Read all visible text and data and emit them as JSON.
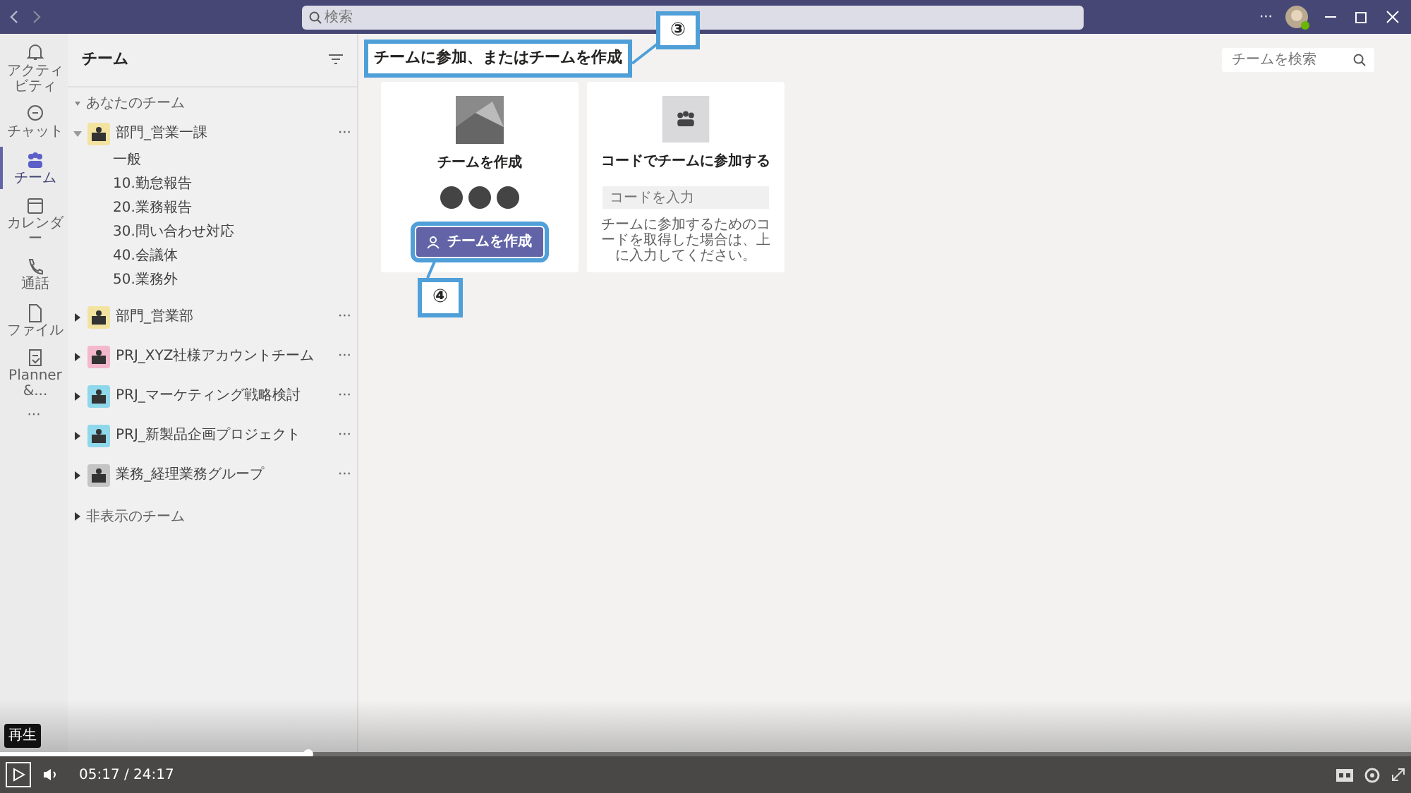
{
  "titlebar": {
    "search_placeholder": "検索",
    "more": "···"
  },
  "rail": [
    {
      "label": "アクティビティ",
      "selected": false
    },
    {
      "label": "チャット",
      "selected": false
    },
    {
      "label": "チーム",
      "selected": true
    },
    {
      "label": "カレンダー",
      "selected": false
    },
    {
      "label": "通話",
      "selected": false
    },
    {
      "label": "ファイル",
      "selected": false
    },
    {
      "label": "Planner &...",
      "selected": false
    }
  ],
  "rail_more": "···",
  "panel": {
    "title": "チーム",
    "section": "あなたのチーム",
    "hidden_section": "非表示のチーム",
    "teams": [
      {
        "name": "部門_営業一課",
        "color": "#f3e3a0",
        "expanded": true,
        "more": "···",
        "channels": [
          "一般",
          "10.勤怠報告",
          "20.業務報告",
          "30.問い合わせ対応",
          "40.会議体",
          "50.業務外"
        ]
      },
      {
        "name": "部門_営業部",
        "color": "#f3e3a0",
        "expanded": false,
        "more": "···"
      },
      {
        "name": "PRJ_XYZ社様アカウントチーム",
        "color": "#f4b8cc",
        "expanded": false,
        "more": "···"
      },
      {
        "name": "PRJ_マーケティング戦略検討",
        "color": "#8fd7ea",
        "expanded": false,
        "more": "···"
      },
      {
        "name": "PRJ_新製品企画プロジェクト",
        "color": "#8fd7ea",
        "expanded": false,
        "more": "···"
      },
      {
        "name": "業務_経理業務グループ",
        "color": "#c4c4c4",
        "expanded": false,
        "more": "···"
      }
    ]
  },
  "main": {
    "heading": "チームに参加、またはチームを作成",
    "team_search_placeholder": "チームを検索",
    "create_card": {
      "title": "チームを作成",
      "button": "チームを作成"
    },
    "join_card": {
      "title": "コードでチームに参加する",
      "placeholder": "コードを入力",
      "hint": "チームに参加するためのコードを取得した場合は、上に入力してください。"
    }
  },
  "callouts": [
    "③",
    "④"
  ],
  "video": {
    "tooltip": "再生",
    "time": "05:17 / 24:17",
    "level": 0.218
  }
}
